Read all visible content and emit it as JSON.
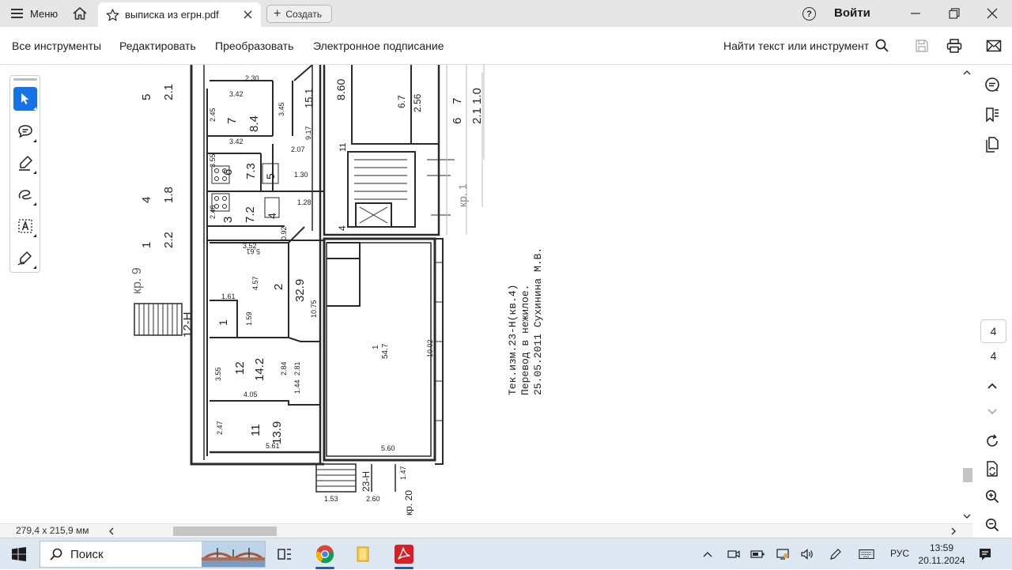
{
  "titlebar": {
    "menu_label": "Меню",
    "tab_title": "выписка из егрн.pdf",
    "create_label": "Создать",
    "help_symbol": "?",
    "login_label": "Войти"
  },
  "toolbar": {
    "items": [
      "Все инструменты",
      "Редактировать",
      "Преобразовать",
      "Электронное подписание"
    ],
    "find_label": "Найти текст или инструмент"
  },
  "left_tools": [
    "select-pointer-icon",
    "add-comment-icon",
    "highlight-pen-icon",
    "draw-freehand-icon",
    "text-select-icon",
    "sign-icon"
  ],
  "right_panel": {
    "page_current": "4",
    "page_total": "4"
  },
  "plan": {
    "note_line1": "Тек.изм.23-Н(кв.4)",
    "note_line2": "Перевод в нежилое.",
    "note_line3": "25.05.2011  Сухинина М.В.",
    "room_labels": [
      {
        "n": "7",
        "a": "8.4"
      },
      {
        "n": "6",
        "a": "7.3"
      },
      {
        "n": "5",
        "a": ""
      },
      {
        "n": "3",
        "a": "7.2"
      },
      {
        "n": "4",
        "a": ""
      },
      {
        "n": "2",
        "a": "32.9"
      },
      {
        "n": "1",
        "a": ""
      },
      {
        "n": "12",
        "a": "14.2"
      },
      {
        "n": "11",
        "a": "13.9"
      },
      {
        "n": "1",
        "a": "54.7"
      }
    ],
    "dims": [
      "5.61",
      "3.52",
      "4.57",
      "1.61",
      "1.59",
      "10.75",
      "3.55",
      "4.05",
      "2.84",
      "2.81",
      "1.44",
      "2.47",
      "5.61",
      "3.42",
      "3.42",
      "3.45",
      "2.45",
      "2.30",
      "9.17",
      "2.07",
      "1.30",
      "3.55",
      "1.28",
      "2.46",
      "0.92",
      "5.60",
      "10.02",
      "2.60",
      "1.47",
      "1.53",
      "8.60",
      "6.7",
      "2.56"
    ],
    "stair_labels": [
      "кр. 9",
      "12-Н",
      "кр. 1",
      "23-Н",
      "кр. 20"
    ],
    "top_numbers": [
      "1",
      "2.2",
      "4",
      "1.8",
      "5",
      "2.1",
      "6",
      "2.1",
      "7",
      "1.0",
      "15.1",
      "11",
      "4"
    ]
  },
  "status": {
    "page_size": "279,4 x 215,9 мм"
  },
  "taskbar": {
    "search_placeholder": "Поиск",
    "lang": "РУС",
    "time": "13:59",
    "date": "20.11.2024"
  },
  "colors": {
    "accent": "#1473e6",
    "titlebar_bg": "#e6e6e6",
    "taskbar_bg": "#dde7f2",
    "pdf_red": "#d81f26"
  }
}
